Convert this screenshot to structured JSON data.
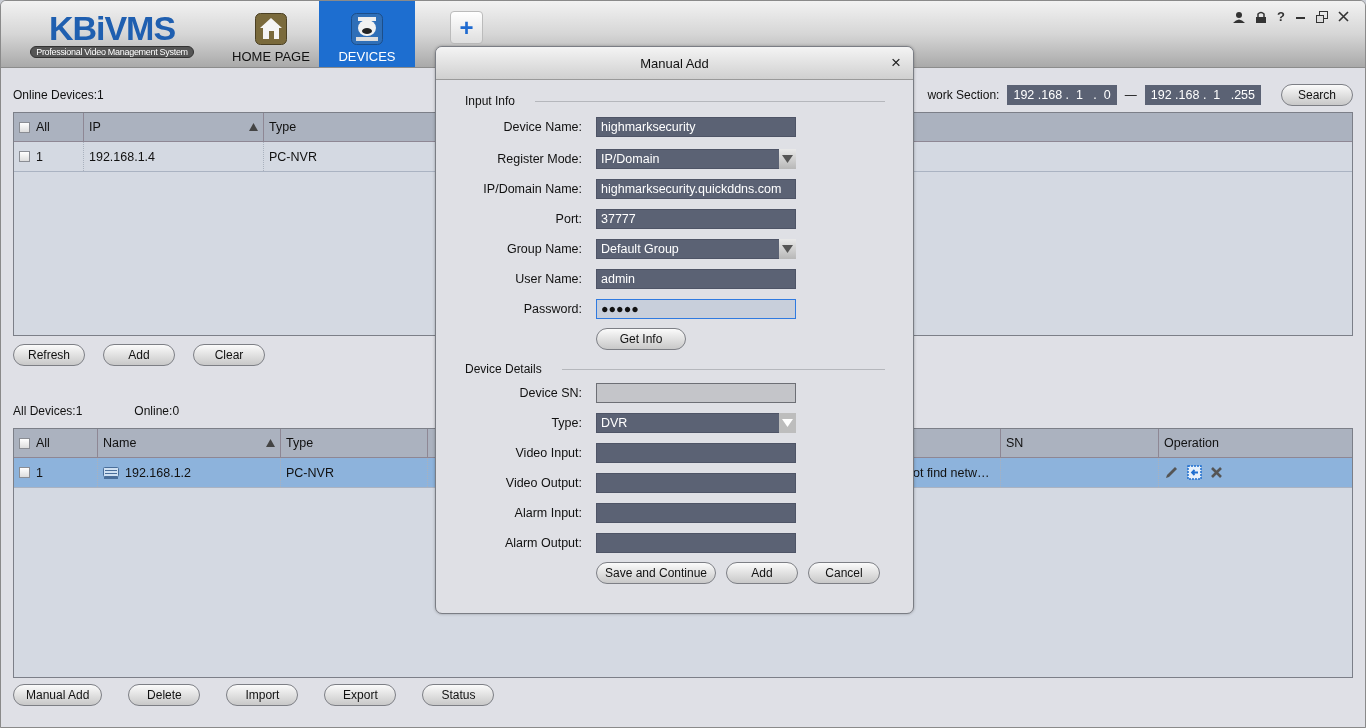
{
  "app": {
    "logo": "KBiVMS",
    "tagline": "Professional Video Management System"
  },
  "tabs": [
    {
      "label": "HOME PAGE",
      "selected": false
    },
    {
      "label": "DEVICES",
      "selected": true
    }
  ],
  "add_tab": "+",
  "window_controls": {
    "help": "?"
  },
  "online_devices": {
    "summary": "Online Devices:1",
    "network_label": "work Section:",
    "range_start": "192 .168 .  1   .  0",
    "range_dash": "—",
    "range_end": "192 .168 .  1   .255",
    "search_button": "Search",
    "all_checked": false,
    "columns": [
      {
        "label": "All"
      },
      {
        "label": "IP",
        "sorted": true
      },
      {
        "label": "Type",
        "sorted": false
      }
    ],
    "rows": [
      {
        "checked": false,
        "number": "1",
        "ip": "192.168.1.4",
        "type": "PC-NVR"
      }
    ],
    "buttons": [
      "Refresh",
      "Add",
      "Clear"
    ]
  },
  "all_devices": {
    "summary": "All Devices:1",
    "online": "Online:0",
    "all_checked": false,
    "columns": [
      {
        "label": "All"
      },
      {
        "label": "Name",
        "sorted": true
      },
      {
        "label": "Type",
        "sorted": false
      },
      {
        "label": "SN",
        "sorted": false
      },
      {
        "label": "Operation",
        "sorted": false
      }
    ],
    "rows": [
      {
        "checked": false,
        "selected": true,
        "number": "1",
        "name": "192.168.1.2",
        "type": "PC-NVR",
        "column_5": "ot find netw…"
      }
    ],
    "buttons": [
      "Manual Add",
      "Delete",
      "Import",
      "Export",
      "Status"
    ]
  },
  "dialog": {
    "title": "Manual Add",
    "close": "×",
    "sections": [
      {
        "title": "Input Info",
        "fields": [
          {
            "label": "Device Name:",
            "kind": "text",
            "value": "highmarksecurity",
            "disabled": false,
            "focused": false
          },
          {
            "label": "Register Mode:",
            "kind": "select",
            "value": "IP/Domain",
            "disabled": false,
            "focused": false
          },
          {
            "label": "IP/Domain Name:",
            "kind": "text",
            "value": "highmarksecurity.quickddns.com",
            "disabled": false,
            "focused": false
          },
          {
            "label": "Port:",
            "kind": "text",
            "value": "37777",
            "disabled": false,
            "focused": false
          },
          {
            "label": "Group Name:",
            "kind": "select",
            "value": "Default Group",
            "disabled": false,
            "focused": false
          },
          {
            "label": "User Name:",
            "kind": "text",
            "value": "admin",
            "disabled": false,
            "focused": false
          },
          {
            "label": "Password:",
            "kind": "text",
            "value": "●●●●●",
            "disabled": false,
            "focused": true
          }
        ],
        "button": "Get Info"
      },
      {
        "title": "Device Details",
        "fields": [
          {
            "label": "Device SN:",
            "kind": "text",
            "disabled": true,
            "focused": false
          },
          {
            "label": "Type:",
            "kind": "select",
            "value": "DVR",
            "disabled": true,
            "focused": false
          },
          {
            "label": "Video Input:",
            "kind": "text",
            "disabled": false,
            "focused": false
          },
          {
            "label": "Video Output:",
            "kind": "text",
            "disabled": false,
            "focused": false
          },
          {
            "label": "Alarm Input:",
            "kind": "text",
            "disabled": false,
            "focused": false
          },
          {
            "label": "Alarm Output:",
            "kind": "text",
            "disabled": false,
            "focused": false
          }
        ]
      }
    ],
    "buttons": [
      "Save and Continue",
      "Add",
      "Cancel"
    ]
  }
}
